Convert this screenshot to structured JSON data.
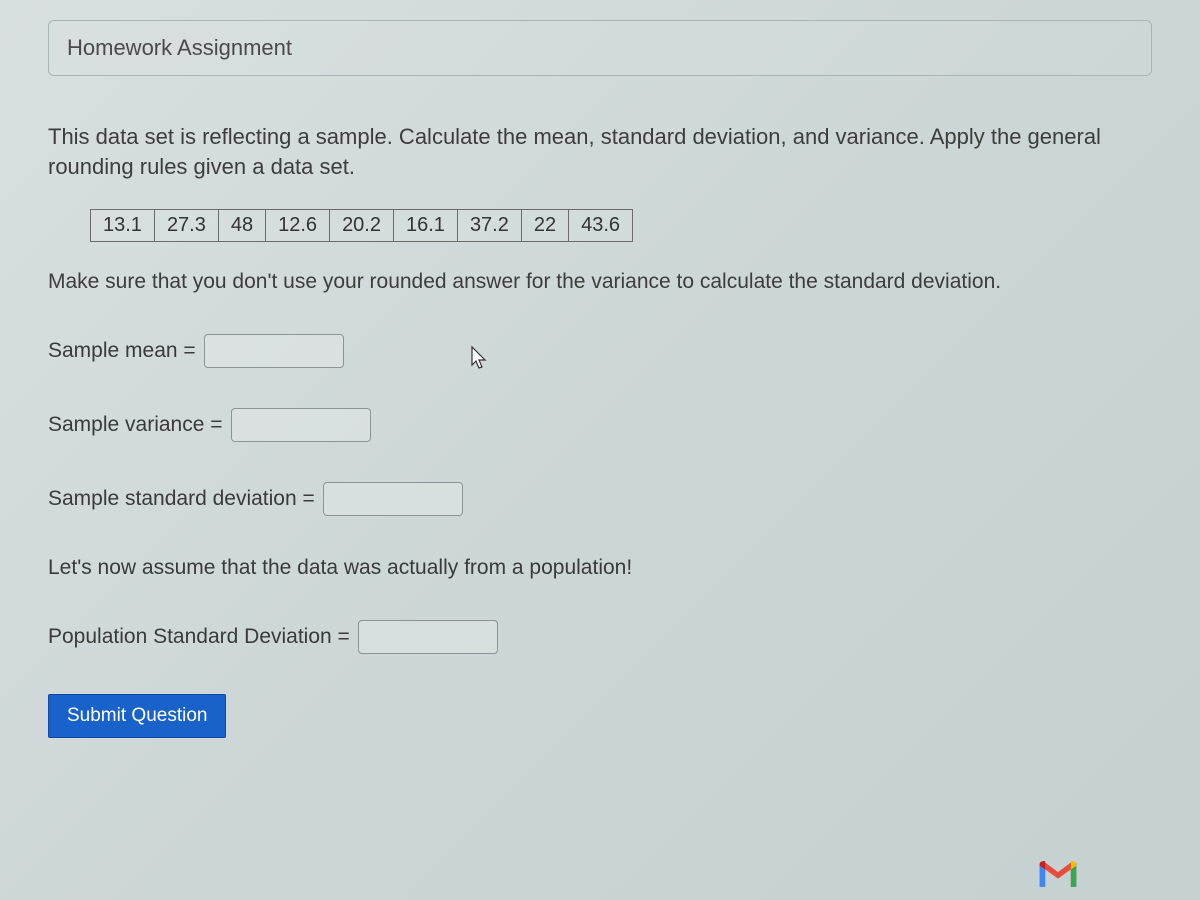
{
  "title": "Homework Assignment",
  "instruction": "This data set is reflecting a sample. Calculate the mean, standard deviation, and variance. Apply the general rounding rules given a data set.",
  "data_values": [
    "13.1",
    "27.3",
    "48",
    "12.6",
    "20.2",
    "16.1",
    "37.2",
    "22",
    "43.6"
  ],
  "note": "Make sure that you don't use your rounded answer for the variance to calculate the standard deviation.",
  "fields": {
    "mean_label": "Sample mean =",
    "variance_label": "Sample variance =",
    "stddev_label": "Sample standard deviation =",
    "pop_stddev_label": "Population Standard Deviation ="
  },
  "assume_text": "Let's now assume that the data was actually from a population!",
  "submit_label": "Submit Question"
}
